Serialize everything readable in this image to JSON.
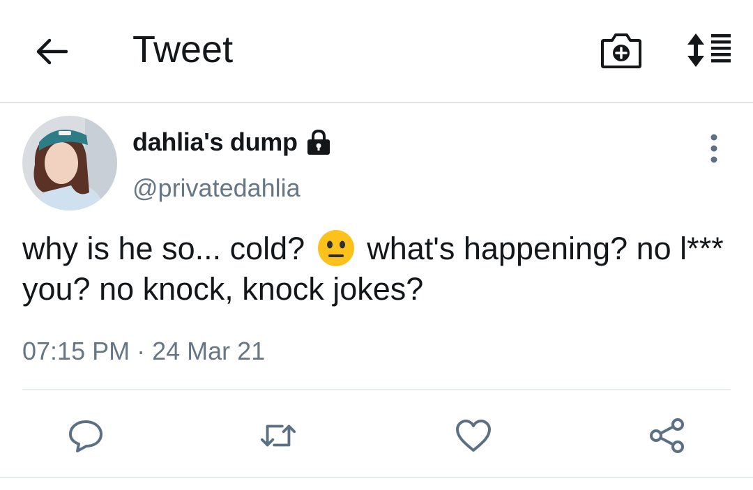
{
  "header": {
    "title": "Tweet",
    "icons": [
      "back-arrow-icon",
      "camera-add-icon",
      "sort-icon"
    ]
  },
  "tweet": {
    "author": {
      "display_name": "dahlia's dump",
      "handle": "@privatedahlia",
      "protected": true
    },
    "text_part1": "why is he so... cold?",
    "emoji": "neutral-face-emoji",
    "text_part2": "what's happening? no l*** you? no knock, knock jokes?",
    "time": "07:15 PM",
    "separator": "·",
    "date": "24 Mar 21"
  },
  "actions": [
    "reply-icon",
    "retweet-icon",
    "like-icon",
    "share-icon"
  ],
  "colors": {
    "text_primary": "#14171a",
    "text_secondary": "#657786",
    "icon": "#5b7083",
    "divider": "#e6ecf0"
  }
}
